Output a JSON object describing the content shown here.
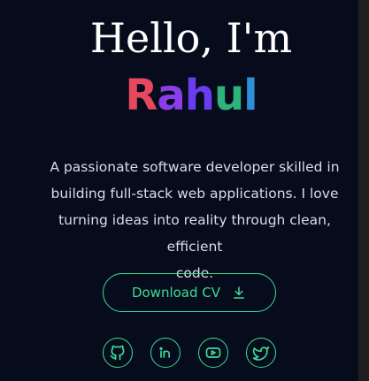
{
  "hero": {
    "greeting": "Hello, I'm",
    "name_letters": [
      {
        "char": "R",
        "color": "#e8485d"
      },
      {
        "char": "a",
        "color": "#8b3dea"
      },
      {
        "char": "h",
        "color": "#6a3cf0"
      },
      {
        "char": "u",
        "color": "#2fb37c"
      },
      {
        "char": "l",
        "color": "#2e8fd8"
      }
    ],
    "tagline_lines": [
      "A passionate software developer skilled in",
      "building full-stack web applications. I love",
      "turning ideas into reality through clean, efficient",
      "code."
    ],
    "download_label": "Download CV",
    "download_icon": "download-icon"
  },
  "socials": [
    {
      "name": "github-icon"
    },
    {
      "name": "linkedin-icon"
    },
    {
      "name": "youtube-icon"
    },
    {
      "name": "twitter-icon"
    }
  ],
  "colors": {
    "background": "#060c1b",
    "accent": "#3ddc97",
    "text": "#ffffff",
    "muted_text": "#d9dde8"
  }
}
